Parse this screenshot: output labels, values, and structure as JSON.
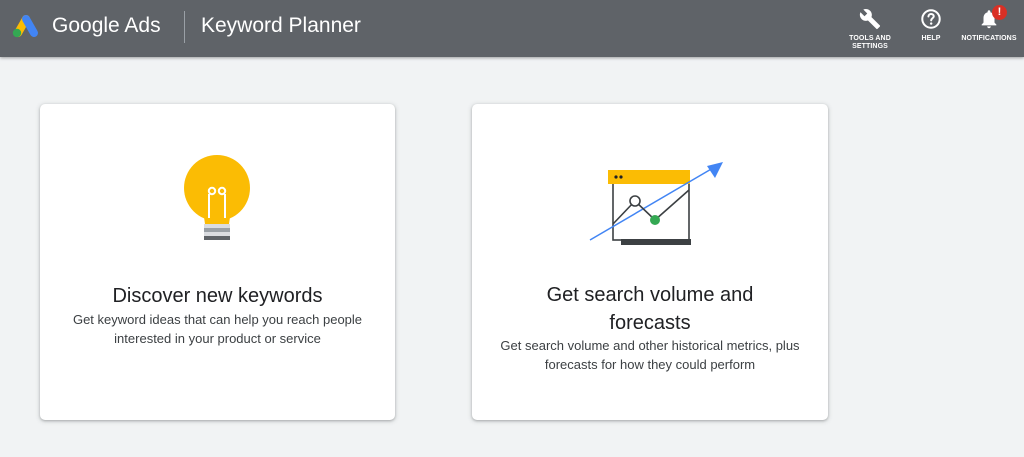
{
  "header": {
    "brand": "Google Ads",
    "product": "Keyword Planner",
    "tools": [
      {
        "label": "TOOLS AND\nSETTINGS",
        "icon": "wrench-icon"
      },
      {
        "label": "HELP",
        "icon": "help-icon"
      },
      {
        "label": "NOTIFICATIONS",
        "icon": "bell-icon",
        "badge": "!"
      }
    ]
  },
  "cards": [
    {
      "title": "Discover new keywords",
      "description": "Get keyword ideas that can help you reach people interested in your product or service",
      "icon": "lightbulb-icon"
    },
    {
      "title": "Get search volume and forecasts",
      "description": "Get search volume and other historical metrics, plus forecasts for how they could perform",
      "icon": "forecast-chart-icon"
    }
  ],
  "colors": {
    "topbar": "#5f6368",
    "background": "#f1f3f4",
    "yellow": "#fbbc04",
    "blue": "#4285f4",
    "green": "#34a853",
    "red": "#d93025"
  }
}
